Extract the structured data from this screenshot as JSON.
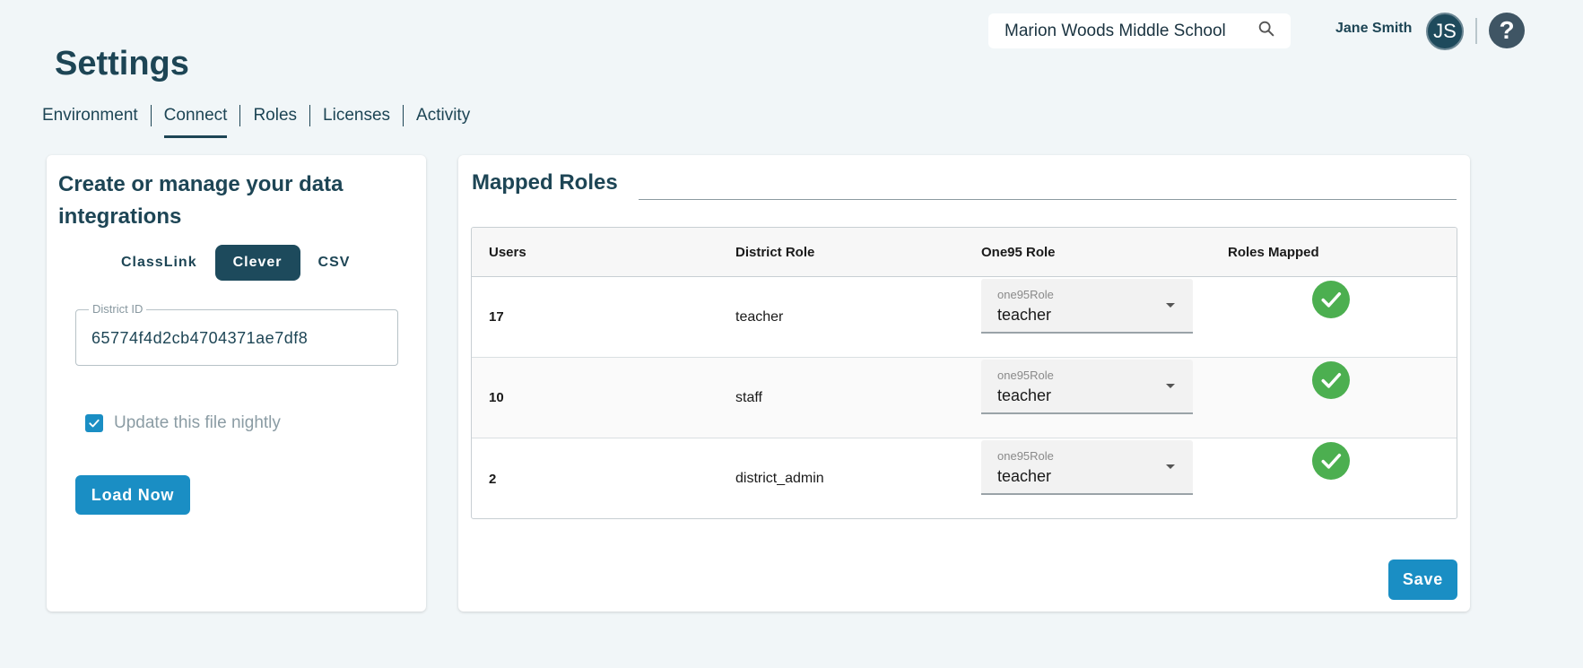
{
  "header": {
    "school": "Marion Woods Middle School",
    "user_name": "Jane Smith",
    "avatar_initials": "JS",
    "help_glyph": "?"
  },
  "page_title": "Settings",
  "tabs": [
    {
      "label": "Environment"
    },
    {
      "label": "Connect",
      "active": true
    },
    {
      "label": "Roles"
    },
    {
      "label": "Licenses"
    },
    {
      "label": "Activity"
    }
  ],
  "integration": {
    "heading": "Create or manage your data integrations",
    "providers": [
      "ClassLink",
      "Clever",
      "CSV"
    ],
    "active_provider": "Clever",
    "district_id_label": "District ID",
    "district_id_value": "65774f4d2cb4704371ae7df8",
    "nightly_label": "Update this file nightly",
    "nightly_checked": true,
    "load_now_label": "Load Now"
  },
  "mapped_roles": {
    "title": "Mapped Roles",
    "columns": [
      "Users",
      "District Role",
      "One95 Role",
      "Roles Mapped"
    ],
    "select_label": "one95Role",
    "rows": [
      {
        "users": "17",
        "district_role": "teacher",
        "one95_role": "teacher",
        "mapped": true
      },
      {
        "users": "10",
        "district_role": "staff",
        "one95_role": "teacher",
        "mapped": true
      },
      {
        "users": "2",
        "district_role": "district_admin",
        "one95_role": "teacher",
        "mapped": true
      }
    ],
    "save_label": "Save"
  },
  "colors": {
    "primary": "#1a8ec4",
    "dark": "#1d4a5c",
    "success": "#4caf50"
  }
}
